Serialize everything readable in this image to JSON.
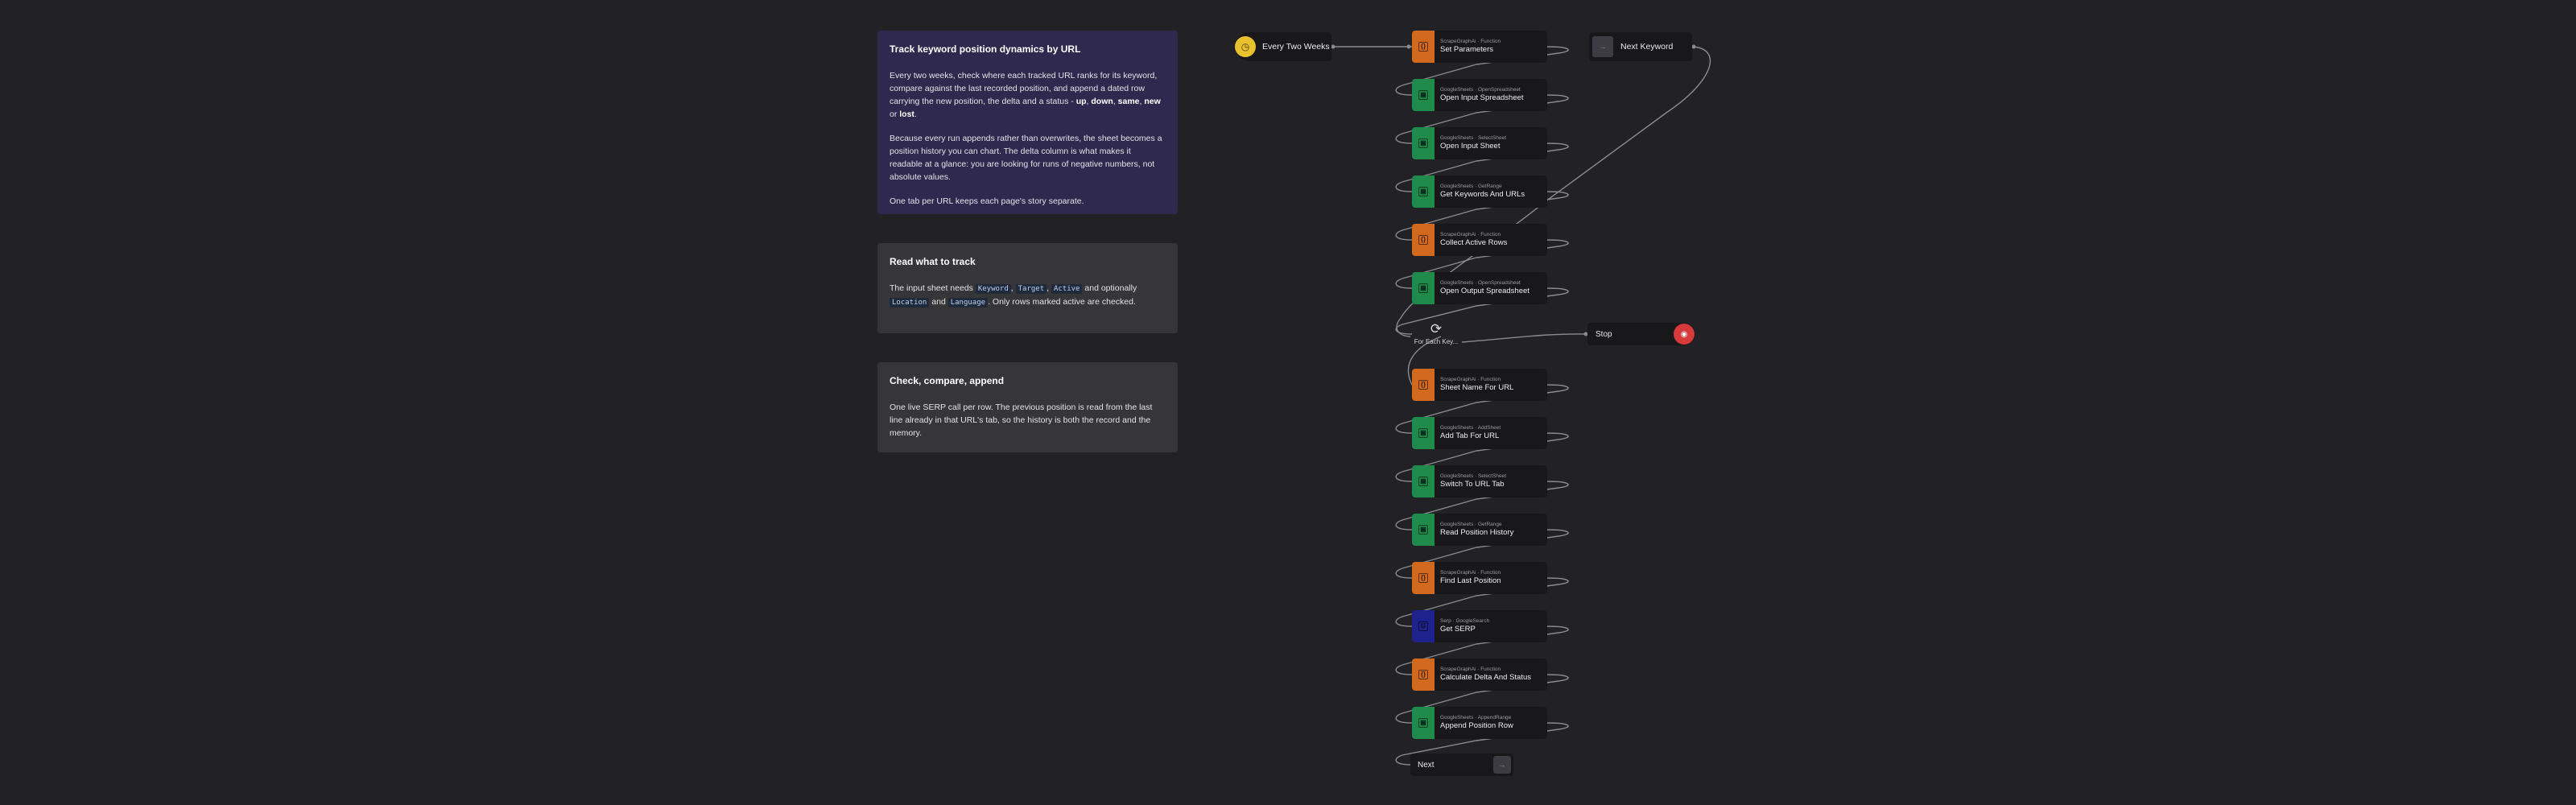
{
  "notes": {
    "main": {
      "title": "Track keyword position dynamics by URL",
      "p1_a": "Every two weeks, check where each tracked URL ranks for its keyword, compare against the last recorded position, and append a dated row carrying the new position, the delta and a status - ",
      "s_up": "up",
      "sep1": ", ",
      "s_down": "down",
      "sep2": ", ",
      "s_same": "same",
      "sep3": ", ",
      "s_new": "new",
      "or": " or ",
      "s_lost": "lost",
      "end": ".",
      "p2": "Because every run appends rather than overwrites, the sheet becomes a position history you can chart. The delta column is what makes it readable at a glance: you are looking for runs of negative numbers, not absolute values.",
      "p3": "One tab per URL keeps each page's story separate."
    },
    "read": {
      "title": "Read what to track",
      "a": "The input sheet needs ",
      "c1": "Keyword",
      "s1": ", ",
      "c2": "Target",
      "s2": ", ",
      "c3": "Active",
      "b": " and optionally ",
      "c4": "Location",
      "and": " and ",
      "c5": "Language",
      "d": ". Only rows marked active are checked."
    },
    "check": {
      "title": "Check, compare, append",
      "body": "One live SERP call per row. The previous position is read from the last line already in that URL's tab, so the history is both the record and the memory."
    }
  },
  "trigger": {
    "name": "Every Two Weeks",
    "icon": "clock-icon"
  },
  "next_keyword": {
    "name": "Next Keyword",
    "icon": "no-op-icon"
  },
  "loop": {
    "name": "For Each Key...",
    "icon": "loop-icon"
  },
  "stop": {
    "name": "Stop",
    "icon": "stop-icon"
  },
  "next": {
    "name": "Next",
    "icon": "no-op-icon"
  },
  "nodes": [
    {
      "key": "set-parameters",
      "sub": "ScrapeGraphAi · Function",
      "name": "Set Parameters",
      "kind": "code",
      "glyph": "{}"
    },
    {
      "key": "open-input-spreadsheet",
      "sub": "GoogleSheets · OpenSpreadsheet",
      "name": "Open Input Spreadsheet",
      "kind": "sheets",
      "glyph": "▦"
    },
    {
      "key": "open-input-sheet",
      "sub": "GoogleSheets · SelectSheet",
      "name": "Open Input Sheet",
      "kind": "sheets",
      "glyph": "▦"
    },
    {
      "key": "get-keywords-and-urls",
      "sub": "GoogleSheets · GetRange",
      "name": "Get Keywords And URLs",
      "kind": "sheets",
      "glyph": "▦"
    },
    {
      "key": "collect-active-rows",
      "sub": "ScrapeGraphAi · Function",
      "name": "Collect Active Rows",
      "kind": "code",
      "glyph": "{}"
    },
    {
      "key": "open-output-spreadsheet",
      "sub": "GoogleSheets · OpenSpreadsheet",
      "name": "Open Output Spreadsheet",
      "kind": "sheets",
      "glyph": "▦"
    },
    {
      "key": "sheet-name-for-url",
      "sub": "ScrapeGraphAi · Function",
      "name": "Sheet Name For URL",
      "kind": "code",
      "glyph": "{}"
    },
    {
      "key": "add-tab-for-url",
      "sub": "GoogleSheets · AddSheet",
      "name": "Add Tab For URL",
      "kind": "sheets",
      "glyph": "▦"
    },
    {
      "key": "switch-to-url-tab",
      "sub": "GoogleSheets · SelectSheet",
      "name": "Switch To URL Tab",
      "kind": "sheets",
      "glyph": "▦"
    },
    {
      "key": "read-position-history",
      "sub": "GoogleSheets · GetRange",
      "name": "Read Position History",
      "kind": "sheets",
      "glyph": "▦"
    },
    {
      "key": "find-last-position",
      "sub": "ScrapeGraphAi · Function",
      "name": "Find Last Position",
      "kind": "code",
      "glyph": "{}"
    },
    {
      "key": "get-serp",
      "sub": "Serp · GoogleSearch",
      "name": "Get SERP",
      "kind": "serp",
      "glyph": "G"
    },
    {
      "key": "calculate-delta-and-status",
      "sub": "ScrapeGraphAi · Function",
      "name": "Calculate Delta And Status",
      "kind": "code",
      "glyph": "{}"
    },
    {
      "key": "append-position-row",
      "sub": "GoogleSheets · AppendRange",
      "name": "Append Position Row",
      "kind": "sheets",
      "glyph": "▦"
    }
  ],
  "colors": {
    "canvas": "#222226",
    "note_purple": "#30294f",
    "note_gray": "#363639",
    "code": "#d2691e",
    "sheets": "#1f8a4c",
    "serp": "#20228c",
    "trigger": "#e8c12f",
    "stop": "#d63a3a",
    "wire": "#8a8a90"
  }
}
